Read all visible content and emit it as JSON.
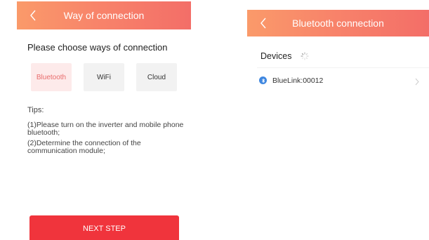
{
  "left_screen": {
    "header": {
      "title": "Way of connection"
    },
    "choose_title": "Please choose ways of connection",
    "options": [
      {
        "label": "Bluetooth",
        "selected": true
      },
      {
        "label": "WiFi",
        "selected": false
      },
      {
        "label": "Cloud",
        "selected": false
      }
    ],
    "tips": {
      "title": "Tips:",
      "items": [
        "(1)Please turn on the inverter and mobile phone bluetooth;",
        "(2)Determine the connection of the communication module;"
      ]
    },
    "next_button_label": "NEXT STEP"
  },
  "right_screen": {
    "header": {
      "title": "Bluetooth connection"
    },
    "devices_label": "Devices",
    "devices": [
      {
        "name": "BlueLink:00012",
        "icon": "bluetooth-icon"
      }
    ]
  },
  "colors": {
    "header_gradient_start": "#fa9a6a",
    "header_gradient_end": "#f36e68",
    "primary_button": "#f0343c",
    "selected_option_bg": "#fdeaea",
    "selected_option_text": "#e96c6c",
    "bluetooth_blue": "#3f87e0"
  }
}
